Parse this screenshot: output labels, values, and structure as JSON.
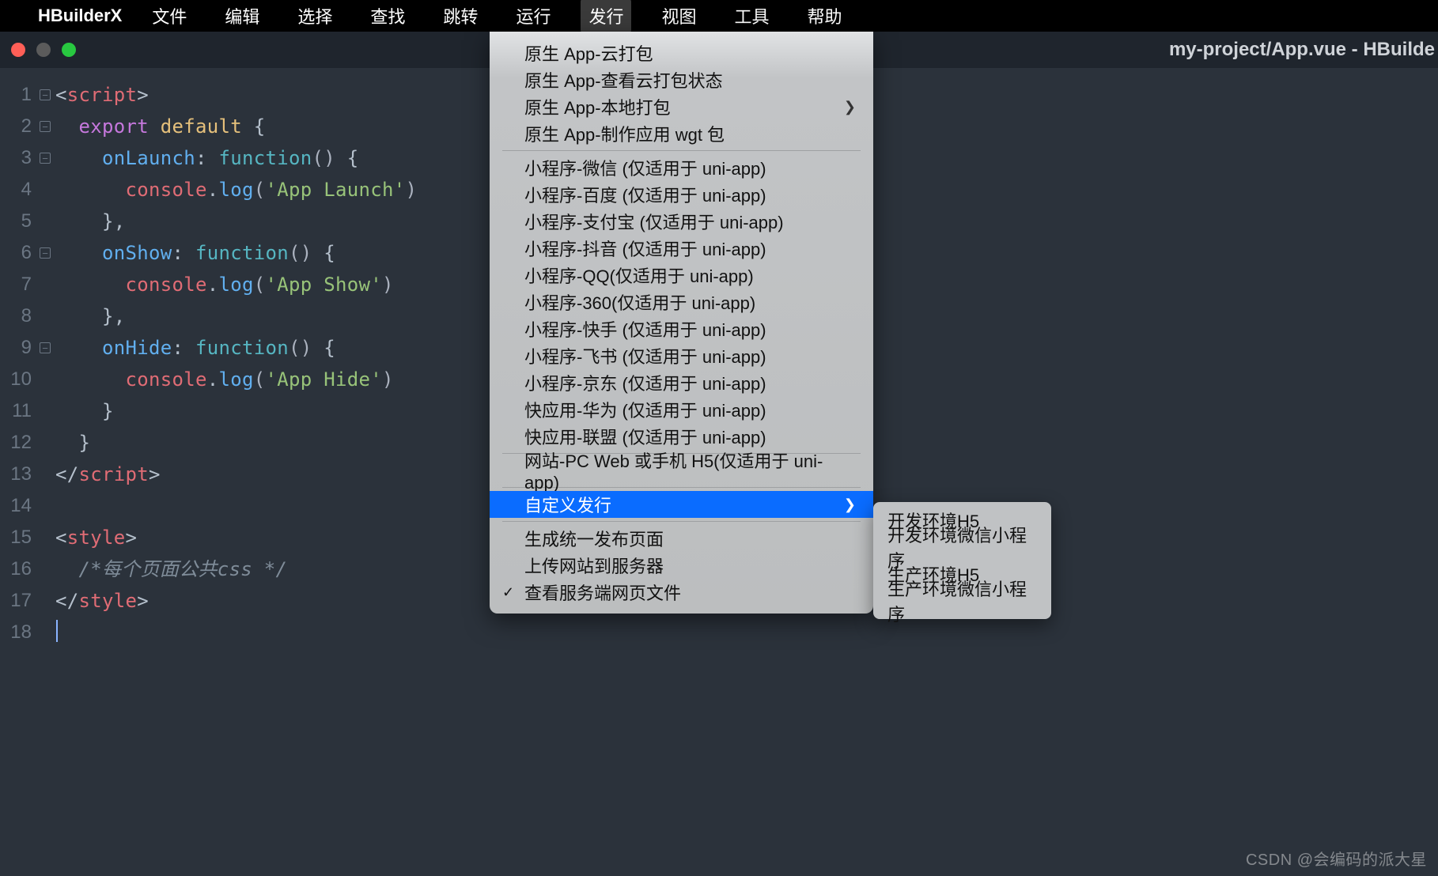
{
  "menubar": {
    "apple_icon": "",
    "app_name": "HBuilderX",
    "items": [
      "文件",
      "编辑",
      "选择",
      "查找",
      "跳转",
      "运行",
      "发行",
      "视图",
      "工具",
      "帮助"
    ],
    "active_index": 6
  },
  "titlebar": {
    "title": "my-project/App.vue - HBuilde"
  },
  "editor": {
    "lines": [
      {
        "n": 1,
        "fold": "−",
        "segments": [
          [
            "c-punct",
            "<"
          ],
          [
            "c-tag",
            "script"
          ],
          [
            "c-punct",
            ">"
          ]
        ]
      },
      {
        "n": 2,
        "fold": "−",
        "indent": "  ",
        "segments": [
          [
            "c-kw",
            "export "
          ],
          [
            "c-def",
            "default "
          ],
          [
            "c-punct",
            "{"
          ]
        ]
      },
      {
        "n": 3,
        "fold": "−",
        "indent": "    ",
        "segments": [
          [
            "c-prop",
            "onLaunch"
          ],
          [
            "c-punct",
            ": "
          ],
          [
            "c-fn",
            "function"
          ],
          [
            "c-paren",
            "() "
          ],
          [
            "c-punct",
            "{"
          ]
        ]
      },
      {
        "n": 4,
        "indent": "      ",
        "segments": [
          [
            "c-obj",
            "console"
          ],
          [
            "c-punct",
            "."
          ],
          [
            "c-method",
            "log"
          ],
          [
            "c-paren",
            "("
          ],
          [
            "c-str",
            "'App Launch'"
          ],
          [
            "c-paren",
            ")"
          ]
        ]
      },
      {
        "n": 5,
        "indent": "    ",
        "segments": [
          [
            "c-punct",
            "},"
          ]
        ]
      },
      {
        "n": 6,
        "fold": "−",
        "indent": "    ",
        "segments": [
          [
            "c-prop",
            "onShow"
          ],
          [
            "c-punct",
            ": "
          ],
          [
            "c-fn",
            "function"
          ],
          [
            "c-paren",
            "() "
          ],
          [
            "c-punct",
            "{"
          ]
        ]
      },
      {
        "n": 7,
        "indent": "      ",
        "segments": [
          [
            "c-obj",
            "console"
          ],
          [
            "c-punct",
            "."
          ],
          [
            "c-method",
            "log"
          ],
          [
            "c-paren",
            "("
          ],
          [
            "c-str",
            "'App Show'"
          ],
          [
            "c-paren",
            ")"
          ]
        ]
      },
      {
        "n": 8,
        "indent": "    ",
        "segments": [
          [
            "c-punct",
            "},"
          ]
        ]
      },
      {
        "n": 9,
        "fold": "−",
        "indent": "    ",
        "segments": [
          [
            "c-prop",
            "onHide"
          ],
          [
            "c-punct",
            ": "
          ],
          [
            "c-fn",
            "function"
          ],
          [
            "c-paren",
            "() "
          ],
          [
            "c-punct",
            "{"
          ]
        ]
      },
      {
        "n": 10,
        "indent": "      ",
        "segments": [
          [
            "c-obj",
            "console"
          ],
          [
            "c-punct",
            "."
          ],
          [
            "c-method",
            "log"
          ],
          [
            "c-paren",
            "("
          ],
          [
            "c-str",
            "'App Hide'"
          ],
          [
            "c-paren",
            ")"
          ]
        ]
      },
      {
        "n": 11,
        "indent": "    ",
        "segments": [
          [
            "c-punct",
            "}"
          ]
        ]
      },
      {
        "n": 12,
        "indent": "  ",
        "segments": [
          [
            "c-punct",
            "}"
          ]
        ]
      },
      {
        "n": 13,
        "segments": [
          [
            "c-punct",
            "</"
          ],
          [
            "c-tag",
            "script"
          ],
          [
            "c-punct",
            ">"
          ]
        ]
      },
      {
        "n": 14,
        "segments": []
      },
      {
        "n": 15,
        "segments": [
          [
            "c-punct",
            "<"
          ],
          [
            "c-tag",
            "style"
          ],
          [
            "c-punct",
            ">"
          ]
        ]
      },
      {
        "n": 16,
        "indent": "  ",
        "segments": [
          [
            "c-comment",
            "/*每个页面公共css */"
          ]
        ]
      },
      {
        "n": 17,
        "segments": [
          [
            "c-punct",
            "</"
          ],
          [
            "c-tag",
            "style"
          ],
          [
            "c-punct",
            ">"
          ]
        ]
      },
      {
        "n": 18,
        "cursor": true,
        "segments": []
      }
    ]
  },
  "dropdown": {
    "groups": [
      [
        {
          "label": "原生 App-云打包"
        },
        {
          "label": "原生 App-查看云打包状态"
        },
        {
          "label": "原生 App-本地打包",
          "submenu": true
        },
        {
          "label": "原生 App-制作应用 wgt 包"
        }
      ],
      [
        {
          "label": "小程序-微信 (仅适用于 uni-app)"
        },
        {
          "label": "小程序-百度 (仅适用于 uni-app)"
        },
        {
          "label": "小程序-支付宝 (仅适用于 uni-app)"
        },
        {
          "label": "小程序-抖音 (仅适用于 uni-app)"
        },
        {
          "label": "小程序-QQ(仅适用于 uni-app)"
        },
        {
          "label": "小程序-360(仅适用于 uni-app)"
        },
        {
          "label": "小程序-快手 (仅适用于 uni-app)"
        },
        {
          "label": "小程序-飞书 (仅适用于 uni-app)"
        },
        {
          "label": "小程序-京东 (仅适用于 uni-app)"
        },
        {
          "label": "快应用-华为 (仅适用于 uni-app)"
        },
        {
          "label": "快应用-联盟 (仅适用于 uni-app)"
        }
      ],
      [
        {
          "label": "网站-PC Web 或手机 H5(仅适用于 uni-app)"
        }
      ],
      [
        {
          "label": "自定义发行",
          "submenu": true,
          "highlight": true
        }
      ],
      [
        {
          "label": "生成统一发布页面"
        },
        {
          "label": "上传网站到服务器"
        },
        {
          "label": "查看服务端网页文件",
          "checked": true
        }
      ]
    ]
  },
  "submenu": {
    "items": [
      "开发环境H5",
      "开发环境微信小程序",
      "生产环境H5",
      "生产环境微信小程序"
    ]
  },
  "watermark": "CSDN @会编码的派大星"
}
